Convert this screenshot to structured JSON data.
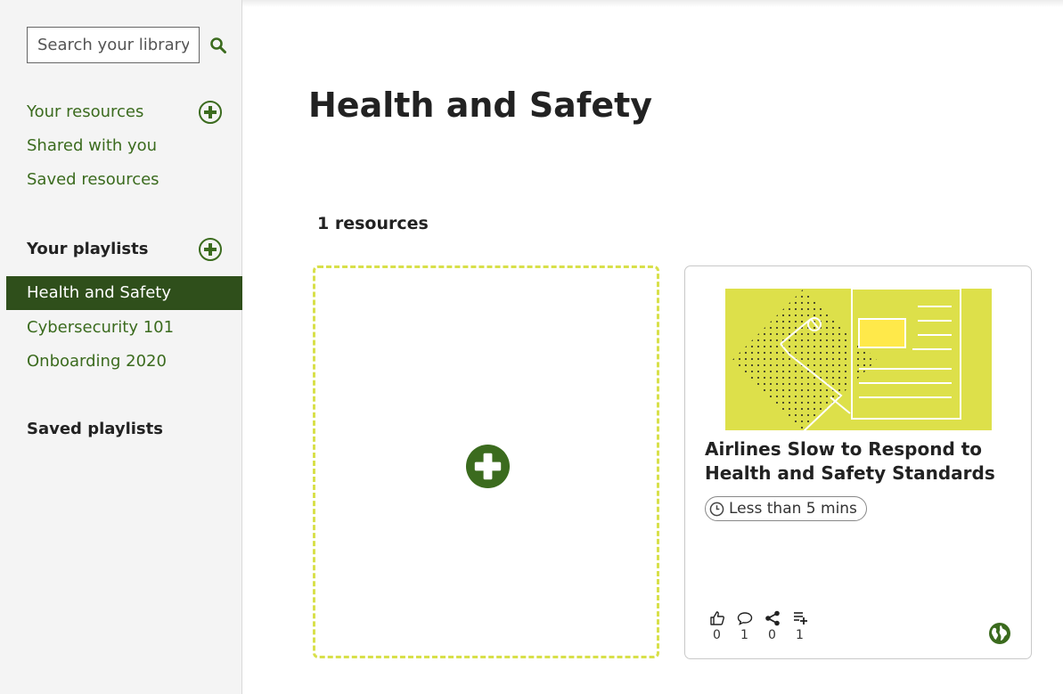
{
  "search": {
    "placeholder": "Search your library"
  },
  "sidebar": {
    "your_resources": "Your resources",
    "shared_with_you": "Shared with you",
    "saved_resources": "Saved resources",
    "your_playlists": "Your playlists",
    "playlists": [
      {
        "label": "Health and Safety",
        "active": true
      },
      {
        "label": "Cybersecurity 101",
        "active": false
      },
      {
        "label": "Onboarding 2020",
        "active": false
      }
    ],
    "saved_playlists": "Saved playlists"
  },
  "main": {
    "title": "Health and Safety",
    "count_label": "1 resources",
    "resource": {
      "title": "Airlines Slow to Respond to Health and Safety Standards",
      "duration": "Less than 5 mins",
      "likes": "0",
      "comments": "1",
      "shares": "0",
      "playlist_adds": "1"
    }
  },
  "colors": {
    "brand_green": "#3b6b1e",
    "active_bg": "#2f4f1b",
    "thumb_yellow": "#dde04a",
    "dashed_border": "#d8e04a"
  },
  "icons": [
    "search-icon",
    "add-circle-icon",
    "clock-icon",
    "thumbs-up-icon",
    "comment-icon",
    "share-icon",
    "add-to-playlist-icon",
    "globe-icon"
  ]
}
